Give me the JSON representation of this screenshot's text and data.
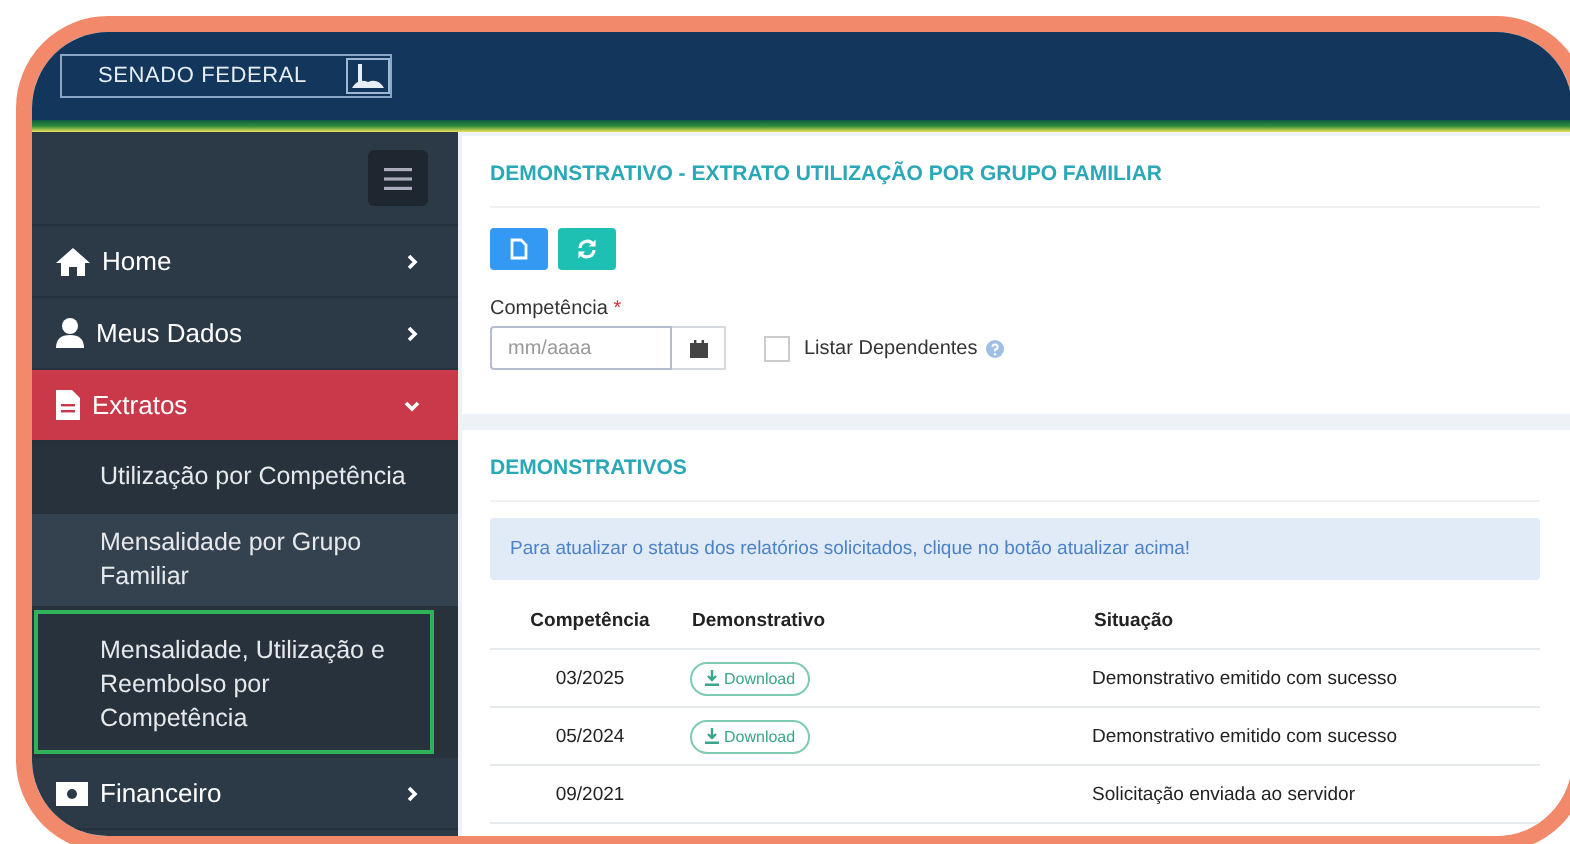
{
  "header": {
    "logo_text": "SENADO FEDERAL"
  },
  "sidebar": {
    "items": [
      {
        "label": "Home",
        "kind": "home",
        "selected": false,
        "expanded": false
      },
      {
        "label": "Meus Dados",
        "kind": "user",
        "selected": false,
        "expanded": false
      },
      {
        "label": "Extratos",
        "kind": "file",
        "selected": true,
        "expanded": true,
        "children": [
          {
            "label": "Utilização por Competência",
            "highlighted": false
          },
          {
            "label": "Mensalidade por Grupo Familiar",
            "highlighted": false
          },
          {
            "label": "Mensalidade, Utilização e Reembolso por Competência",
            "highlighted": true
          }
        ]
      },
      {
        "label": "Financeiro",
        "kind": "money",
        "selected": false,
        "expanded": false
      }
    ]
  },
  "form": {
    "title": "DEMONSTRATIVO - EXTRATO UTILIZAÇÃO POR GRUPO FAMILIAR",
    "competencia": {
      "label": "Competência",
      "required_mark": "*",
      "placeholder": "mm/aaaa"
    },
    "listar_dependentes": {
      "label": "Listar Dependentes",
      "checked": false
    }
  },
  "demonstrativos": {
    "title": "DEMONSTRATIVOS",
    "info": "Para atualizar o status dos relatórios solicitados, clique no botão atualizar acima!",
    "columns": [
      "Competência",
      "Demonstrativo",
      "Situação"
    ],
    "rows": [
      {
        "competencia": "03/2025",
        "download": "Download",
        "situacao": "Demonstrativo emitido com sucesso"
      },
      {
        "competencia": "05/2024",
        "download": "Download",
        "situacao": "Demonstrativo emitido com sucesso"
      },
      {
        "competencia": "09/2021",
        "situacao": "Solicitação enviada ao servidor"
      }
    ]
  }
}
